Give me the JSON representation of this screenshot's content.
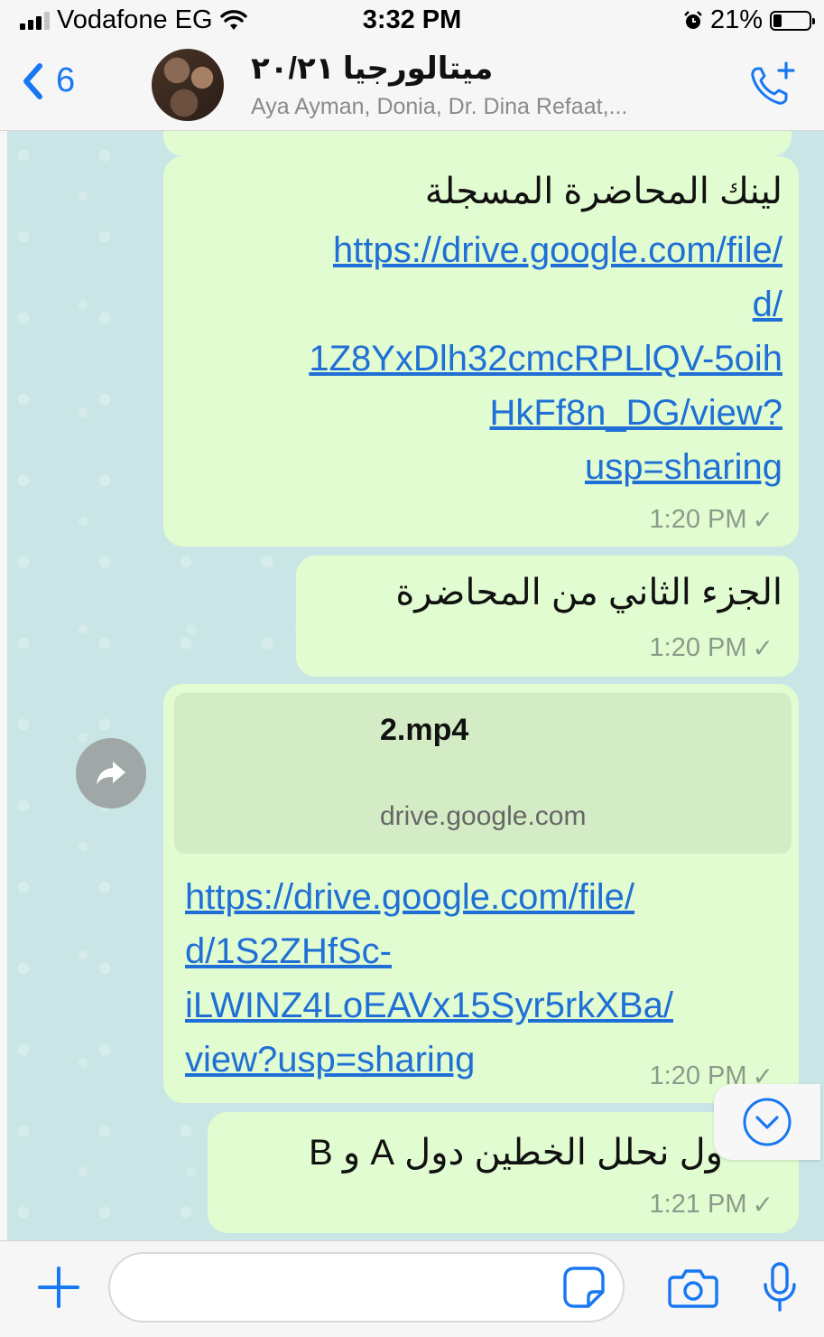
{
  "status_bar": {
    "carrier": "Vodafone EG",
    "time": "3:32 PM",
    "battery": "21%"
  },
  "header": {
    "back_count": "6",
    "title": "ميتالورجيا ٢٠/٢١",
    "members": "Aya Ayman, Donia, Dr. Dina Refaat,..."
  },
  "messages": [
    {
      "text": "لينك المحاضرة المسجلة",
      "link_lines": [
        "https://drive.google.com/file/",
        "d/",
        "1Z8YxDlh32cmcRPLlQV-5oih",
        "HkFf8n_DG/view?",
        "usp=sharing"
      ],
      "time": "1:20 PM"
    },
    {
      "text": "الجزء الثاني من المحاضرة",
      "time": "1:20 PM"
    },
    {
      "preview_title": "2.mp4",
      "preview_domain": "drive.google.com",
      "link_lines": [
        "https://drive.google.com/file/",
        "d/1S2ZHfSc-",
        "iLWINZ4LoEAVx15Syr5rkXBa/",
        "view?usp=sharing"
      ],
      "time": "1:20 PM"
    },
    {
      "text": "ول نحلل الخطين دول A  و B",
      "time": "1:21 PM"
    }
  ],
  "input": {
    "placeholder": ""
  },
  "colors": {
    "accent": "#1877f2",
    "bubble": "#e1fcd0",
    "link": "#1f6fd6",
    "chat_bg": "#c9e5e6"
  },
  "icons": [
    "signal-icon",
    "wifi-icon",
    "alarm-icon",
    "battery-icon",
    "back-chevron-icon",
    "add-call-icon",
    "forward-icon",
    "scroll-down-icon",
    "plus-icon",
    "sticker-icon",
    "camera-icon",
    "microphone-icon",
    "read-check-icon"
  ]
}
